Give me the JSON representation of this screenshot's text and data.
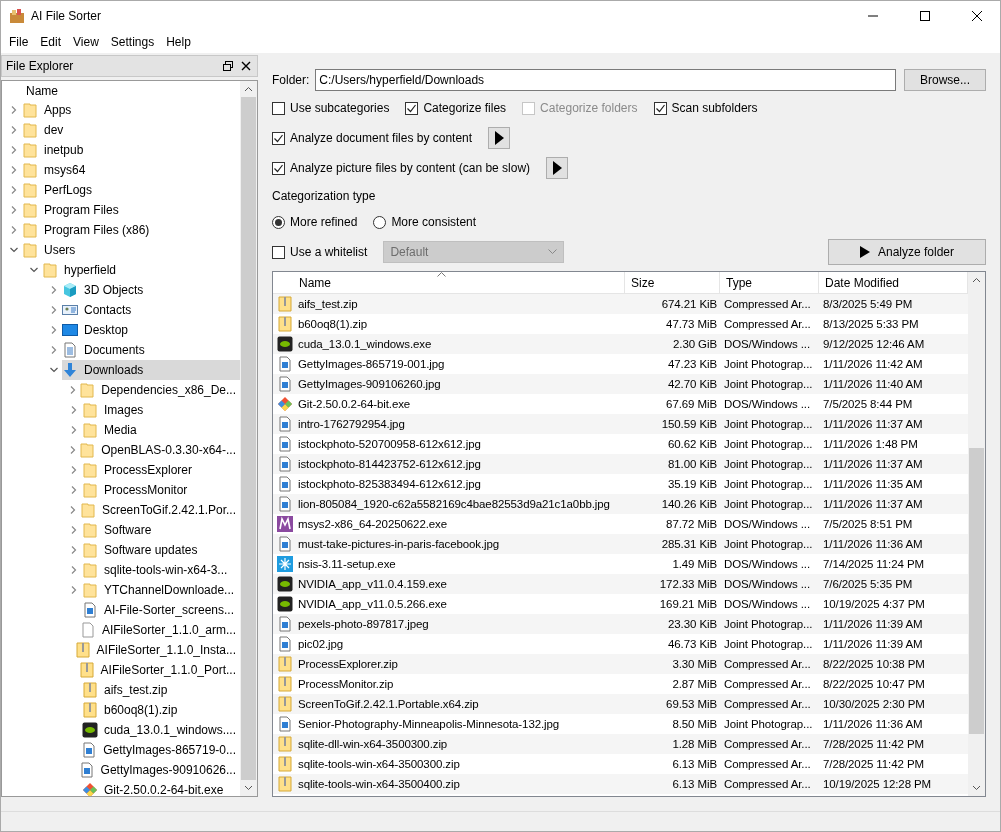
{
  "window": {
    "title": "AI File Sorter"
  },
  "menu": [
    "File",
    "Edit",
    "View",
    "Settings",
    "Help"
  ],
  "explorer": {
    "title": "File Explorer",
    "column": "Name",
    "tree": [
      {
        "label": "Apps",
        "kind": "folder",
        "expanded": false,
        "selected": false
      },
      {
        "label": "dev",
        "kind": "folder",
        "expanded": false,
        "selected": false
      },
      {
        "label": "inetpub",
        "kind": "folder",
        "expanded": false,
        "selected": false
      },
      {
        "label": "msys64",
        "kind": "folder",
        "expanded": false,
        "selected": false
      },
      {
        "label": "PerfLogs",
        "kind": "folder",
        "expanded": false,
        "selected": false
      },
      {
        "label": "Program Files",
        "kind": "folder",
        "expanded": false,
        "selected": false
      },
      {
        "label": "Program Files (x86)",
        "kind": "folder",
        "expanded": false,
        "selected": false
      },
      {
        "label": "Users",
        "kind": "folder",
        "expanded": true,
        "selected": false,
        "children": [
          {
            "label": "hyperfield",
            "kind": "folder",
            "expanded": true,
            "selected": false,
            "children": [
              {
                "label": "3D Objects",
                "kind": "cube",
                "expanded": false,
                "selected": false
              },
              {
                "label": "Contacts",
                "kind": "contacts",
                "expanded": false,
                "selected": false
              },
              {
                "label": "Desktop",
                "kind": "desktop",
                "expanded": false,
                "selected": false
              },
              {
                "label": "Documents",
                "kind": "document",
                "expanded": false,
                "selected": false
              },
              {
                "label": "Downloads",
                "kind": "download",
                "expanded": true,
                "selected": true,
                "children": [
                  {
                    "label": "Dependencies_x86_De...",
                    "kind": "folder",
                    "expanded": false,
                    "selected": false
                  },
                  {
                    "label": "Images",
                    "kind": "folder",
                    "expanded": false,
                    "selected": false
                  },
                  {
                    "label": "Media",
                    "kind": "folder",
                    "expanded": false,
                    "selected": false
                  },
                  {
                    "label": "OpenBLAS-0.3.30-x64-...",
                    "kind": "folder",
                    "expanded": false,
                    "selected": false
                  },
                  {
                    "label": "ProcessExplorer",
                    "kind": "folder",
                    "expanded": false,
                    "selected": false
                  },
                  {
                    "label": "ProcessMonitor",
                    "kind": "folder",
                    "expanded": false,
                    "selected": false
                  },
                  {
                    "label": "ScreenToGif.2.42.1.Por...",
                    "kind": "folder",
                    "expanded": false,
                    "selected": false
                  },
                  {
                    "label": "Software",
                    "kind": "folder",
                    "expanded": false,
                    "selected": false
                  },
                  {
                    "label": "Software updates",
                    "kind": "folder",
                    "expanded": false,
                    "selected": false
                  },
                  {
                    "label": "sqlite-tools-win-x64-3...",
                    "kind": "folder",
                    "expanded": false,
                    "selected": false
                  },
                  {
                    "label": "YTChannelDownloade...",
                    "kind": "folder",
                    "expanded": false,
                    "selected": false
                  },
                  {
                    "label": "AI-File-Sorter_screens...",
                    "kind": "image",
                    "selected": false
                  },
                  {
                    "label": "AIFileSorter_1.1.0_arm...",
                    "kind": "file",
                    "selected": false
                  },
                  {
                    "label": "AIFileSorter_1.1.0_Insta...",
                    "kind": "zip",
                    "selected": false
                  },
                  {
                    "label": "AIFileSorter_1.1.0_Port...",
                    "kind": "zip",
                    "selected": false
                  },
                  {
                    "label": "aifs_test.zip",
                    "kind": "zip",
                    "selected": false
                  },
                  {
                    "label": "b60oq8(1).zip",
                    "kind": "zip",
                    "selected": false
                  },
                  {
                    "label": "cuda_13.0.1_windows....",
                    "kind": "nvidia",
                    "selected": false
                  },
                  {
                    "label": "GettyImages-865719-0...",
                    "kind": "image",
                    "selected": false
                  },
                  {
                    "label": "GettyImages-90910626...",
                    "kind": "image",
                    "selected": false
                  },
                  {
                    "label": "Git-2.50.0.2-64-bit.exe",
                    "kind": "git",
                    "selected": false
                  }
                ]
              }
            ]
          }
        ]
      }
    ]
  },
  "folder": {
    "label": "Folder:",
    "value": "C:/Users/hyperfield/Downloads",
    "browse": "Browse..."
  },
  "options": [
    {
      "label": "Use subcategories",
      "checked": false,
      "disabled": false
    },
    {
      "label": "Categorize files",
      "checked": true,
      "disabled": false
    },
    {
      "label": "Categorize folders",
      "checked": false,
      "disabled": true
    },
    {
      "label": "Scan subfolders",
      "checked": true,
      "disabled": false
    }
  ],
  "content_options": [
    {
      "label": "Analyze document files by content",
      "checked": true
    },
    {
      "label": "Analyze picture files by content (can be slow)",
      "checked": true
    }
  ],
  "categorization": {
    "title": "Categorization type",
    "choices": [
      {
        "label": "More refined",
        "selected": true
      },
      {
        "label": "More consistent",
        "selected": false
      }
    ]
  },
  "whitelist": {
    "label": "Use a whitelist",
    "checked": false,
    "value": "Default",
    "disabled": true
  },
  "analyze_button": "Analyze folder",
  "table": {
    "columns": [
      "Name",
      "Size",
      "Type",
      "Date Modified"
    ],
    "rows": [
      {
        "kind": "zip",
        "cells": [
          "aifs_test.zip",
          "674.21 KiB",
          "Compressed Ar...",
          "8/3/2025 5:49 PM"
        ]
      },
      {
        "kind": "zip",
        "cells": [
          "b60oq8(1).zip",
          "47.73 MiB",
          "Compressed Ar...",
          "8/13/2025 5:33 PM"
        ]
      },
      {
        "kind": "nvidia",
        "cells": [
          "cuda_13.0.1_windows.exe",
          "2.30 GiB",
          "DOS/Windows ...",
          "9/12/2025 12:46 AM"
        ]
      },
      {
        "kind": "image",
        "cells": [
          "GettyImages-865719-001.jpg",
          "47.23 KiB",
          "Joint Photograp...",
          "1/11/2026 11:42 AM"
        ]
      },
      {
        "kind": "image",
        "cells": [
          "GettyImages-909106260.jpg",
          "42.70 KiB",
          "Joint Photograp...",
          "1/11/2026 11:40 AM"
        ]
      },
      {
        "kind": "git",
        "cells": [
          "Git-2.50.0.2-64-bit.exe",
          "67.69 MiB",
          "DOS/Windows ...",
          "7/5/2025 8:44 PM"
        ]
      },
      {
        "kind": "image",
        "cells": [
          "intro-1762792954.jpg",
          "150.59 KiB",
          "Joint Photograp...",
          "1/11/2026 11:37 AM"
        ]
      },
      {
        "kind": "image",
        "cells": [
          "istockphoto-520700958-612x612.jpg",
          "60.62 KiB",
          "Joint Photograp...",
          "1/11/2026 1:48 PM"
        ]
      },
      {
        "kind": "image",
        "cells": [
          "istockphoto-814423752-612x612.jpg",
          "81.00 KiB",
          "Joint Photograp...",
          "1/11/2026 11:37 AM"
        ]
      },
      {
        "kind": "image",
        "cells": [
          "istockphoto-825383494-612x612.jpg",
          "35.19 KiB",
          "Joint Photograp...",
          "1/11/2026 11:35 AM"
        ]
      },
      {
        "kind": "image",
        "cells": [
          "lion-805084_1920-c62a5582169c4bae82553d9a21c1a0bb.jpg",
          "140.26 KiB",
          "Joint Photograp...",
          "1/11/2026 11:37 AM"
        ]
      },
      {
        "kind": "msys",
        "cells": [
          "msys2-x86_64-20250622.exe",
          "87.72 MiB",
          "DOS/Windows ...",
          "7/5/2025 8:51 PM"
        ]
      },
      {
        "kind": "image",
        "cells": [
          "must-take-pictures-in-paris-facebook.jpg",
          "285.31 KiB",
          "Joint Photograp...",
          "1/11/2026 11:36 AM"
        ]
      },
      {
        "kind": "nsis",
        "cells": [
          "nsis-3.11-setup.exe",
          "1.49 MiB",
          "DOS/Windows ...",
          "7/14/2025 11:24 PM"
        ]
      },
      {
        "kind": "nvidia",
        "cells": [
          "NVIDIA_app_v11.0.4.159.exe",
          "172.33 MiB",
          "DOS/Windows ...",
          "7/6/2025 5:35 PM"
        ]
      },
      {
        "kind": "nvidia",
        "cells": [
          "NVIDIA_app_v11.0.5.266.exe",
          "169.21 MiB",
          "DOS/Windows ...",
          "10/19/2025 4:37 PM"
        ]
      },
      {
        "kind": "image",
        "cells": [
          "pexels-photo-897817.jpeg",
          "23.30 KiB",
          "Joint Photograp...",
          "1/11/2026 11:39 AM"
        ]
      },
      {
        "kind": "image",
        "cells": [
          "pic02.jpg",
          "46.73 KiB",
          "Joint Photograp...",
          "1/11/2026 11:39 AM"
        ]
      },
      {
        "kind": "zip",
        "cells": [
          "ProcessExplorer.zip",
          "3.30 MiB",
          "Compressed Ar...",
          "8/22/2025 10:38 PM"
        ]
      },
      {
        "kind": "zip",
        "cells": [
          "ProcessMonitor.zip",
          "2.87 MiB",
          "Compressed Ar...",
          "8/22/2025 10:47 PM"
        ]
      },
      {
        "kind": "zip",
        "cells": [
          "ScreenToGif.2.42.1.Portable.x64.zip",
          "69.53 MiB",
          "Compressed Ar...",
          "10/30/2025 2:30 PM"
        ]
      },
      {
        "kind": "image",
        "cells": [
          "Senior-Photography-Minneapolis-Minnesota-132.jpg",
          "8.50 MiB",
          "Joint Photograp...",
          "1/11/2026 11:36 AM"
        ]
      },
      {
        "kind": "zip",
        "cells": [
          "sqlite-dll-win-x64-3500300.zip",
          "1.28 MiB",
          "Compressed Ar...",
          "7/28/2025 11:42 PM"
        ]
      },
      {
        "kind": "zip",
        "cells": [
          "sqlite-tools-win-x64-3500300.zip",
          "6.13 MiB",
          "Compressed Ar...",
          "7/28/2025 11:42 PM"
        ]
      },
      {
        "kind": "zip",
        "cells": [
          "sqlite-tools-win-x64-3500400.zip",
          "6.13 MiB",
          "Compressed Ar...",
          "10/19/2025 12:28 PM"
        ]
      }
    ]
  }
}
